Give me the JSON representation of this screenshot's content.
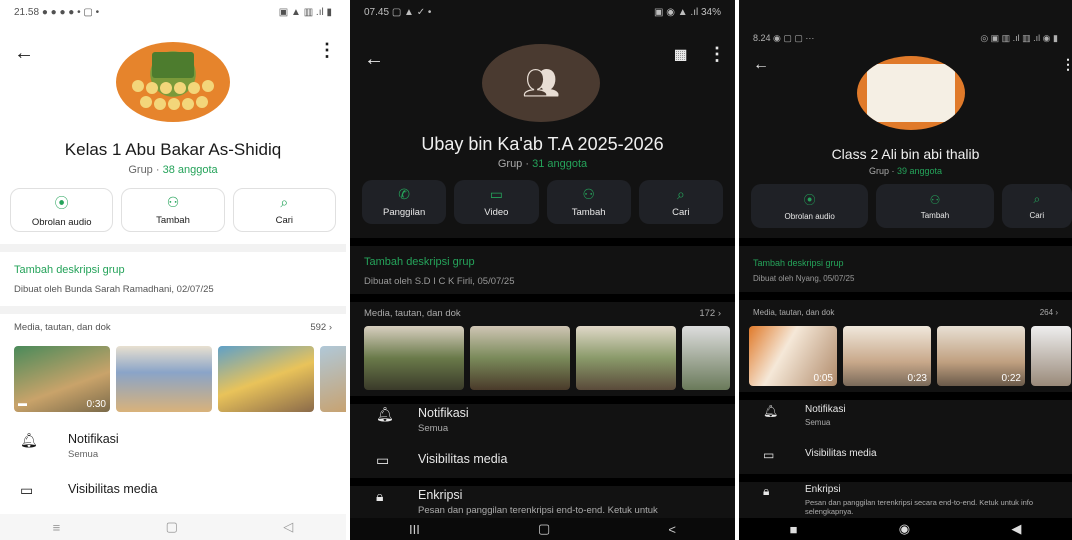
{
  "phone1": {
    "status_time": "21.58",
    "status_icons": "● ● ● ● • ▢ •",
    "status_right": "▣ ▲ ▥ .ıl ▮",
    "group_name": "Kelas 1 Abu Bakar As-Shidiq",
    "group_prefix": "Grup · ",
    "member_count": "38 anggota",
    "actions": [
      "Obrolan audio",
      "Tambah",
      "Cari"
    ],
    "add_description": "Tambah deskripsi grup",
    "created_by": "Dibuat oleh Bunda Sarah Ramadhani, 02/07/25",
    "media_label": "Media, tautan, dan dok",
    "media_count": "592",
    "thumb_duration": "0:30",
    "notif_title": "Notifikasi",
    "notif_sub": "Semua",
    "visibility": "Visibilitas media",
    "nav": [
      "≡",
      "▢",
      "◁"
    ]
  },
  "phone2": {
    "status_time": "07.45",
    "status_icons": "▢ ▲ ✓ •",
    "status_right": "▣ ◉ ▲ .ıl 34%",
    "group_name": "Ubay bin Ka'ab T.A 2025-2026",
    "group_prefix": "Grup · ",
    "member_count": "31 anggota",
    "actions": [
      "Panggilan",
      "Video",
      "Tambah",
      "Cari"
    ],
    "add_description": "Tambah deskripsi grup",
    "created_by": "Dibuat oleh S.D I C K Firli, 05/07/25",
    "media_label": "Media, tautan, dan dok",
    "media_count": "172",
    "notif_title": "Notifikasi",
    "notif_sub": "Semua",
    "visibility": "Visibilitas media",
    "encryption": "Enkripsi",
    "encryption_sub": "Pesan dan panggilan terenkripsi end-to-end. Ketuk untuk info",
    "nav": [
      "III",
      "▢",
      "<"
    ]
  },
  "phone3": {
    "status_time": "8.24",
    "status_icons": "◉ ▢ ▢ ···",
    "status_right": "◎ ▣ ▥ .ıl ▥ .ıl ◉ ▮",
    "group_name": "Class 2 Ali bin abi thalib",
    "group_prefix": "Grup · ",
    "member_count": "39 anggota",
    "actions": [
      "Obrolan audio",
      "Tambah",
      "Cari"
    ],
    "add_description": "Tambah deskripsi grup",
    "created_by": "Dibuat oleh Nyang, 05/07/25",
    "media_label": "Media, tautan, dan dok",
    "media_count": "264",
    "durations": [
      "0:05",
      "0:23",
      "0:22"
    ],
    "notif_title": "Notifikasi",
    "notif_sub": "Semua",
    "visibility": "Visibilitas media",
    "encryption": "Enkripsi",
    "encryption_sub": "Pesan dan panggilan terenkripsi secara end-to-end. Ketuk untuk info selengkapnya.",
    "nav": [
      "■",
      "◉",
      "◀"
    ]
  },
  "colors": {
    "whatsapp_green": "#25a35a",
    "dark_bg": "#121212",
    "dark_card": "#1f2126"
  }
}
